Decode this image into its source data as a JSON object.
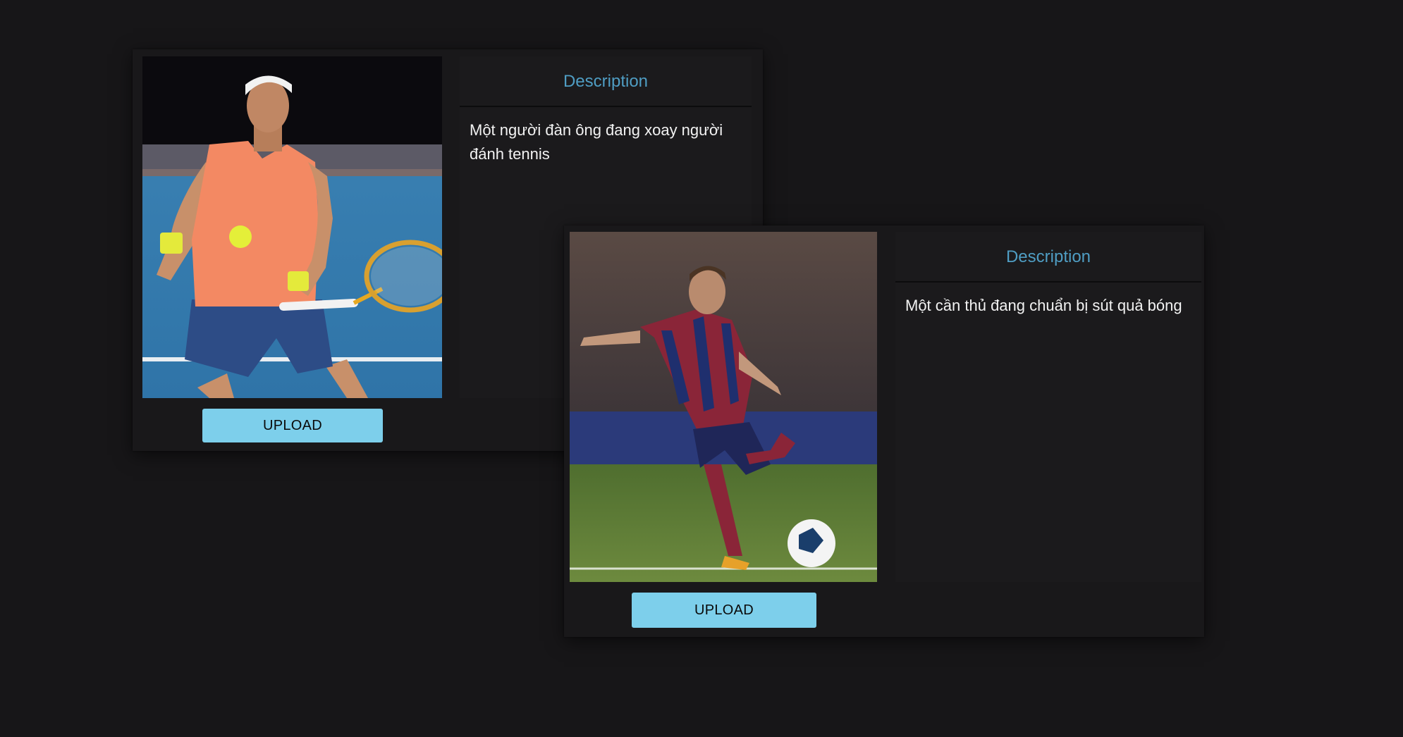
{
  "cards": [
    {
      "image_alt": "Tennis player hitting a forehand",
      "description_title": "Description",
      "description_text": "Một người đàn ông đang xoay người đánh tennis",
      "upload_label": "UPLOAD"
    },
    {
      "image_alt": "Football player about to kick a ball",
      "description_title": "Description",
      "description_text": "Một cần thủ đang chuẩn bị sút quả bóng",
      "upload_label": "UPLOAD"
    }
  ],
  "colors": {
    "background": "#171618",
    "accent_title": "#4f9dc3",
    "upload_button": "#7dcfeb"
  }
}
